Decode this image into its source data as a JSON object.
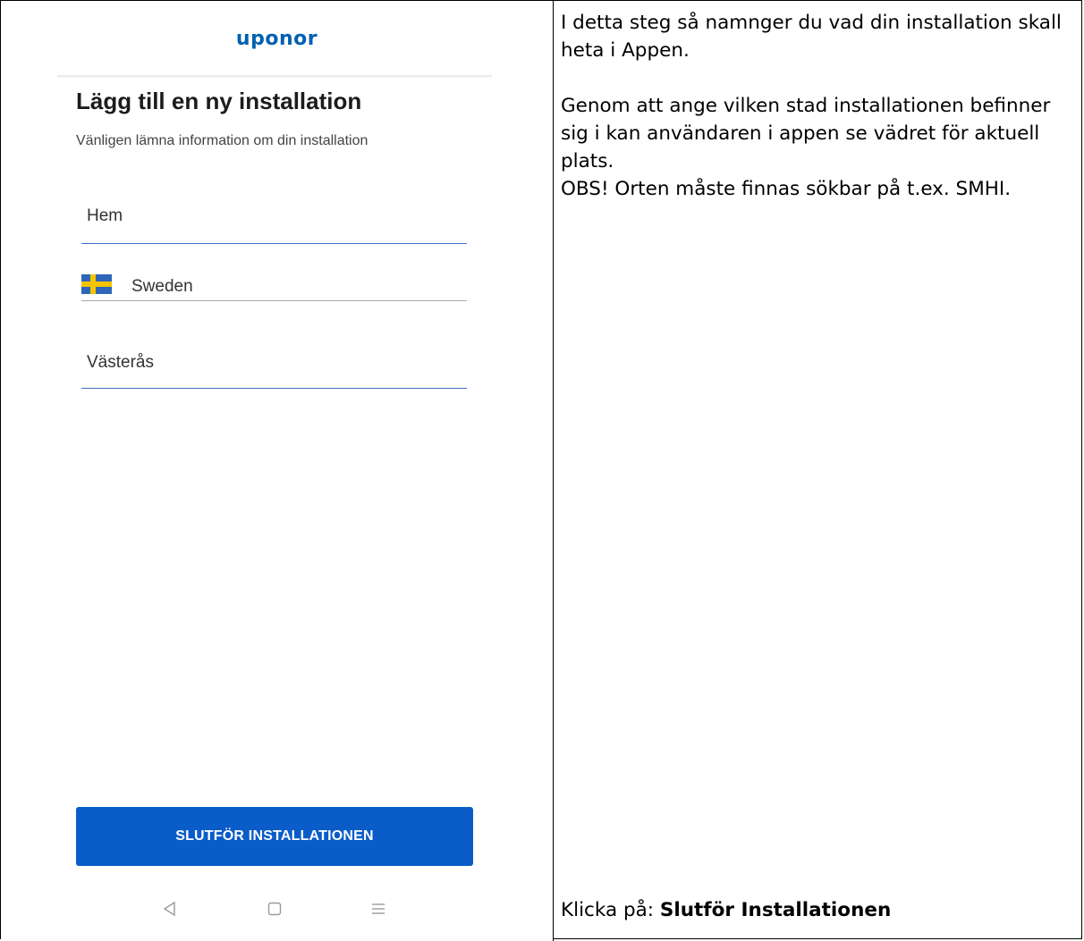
{
  "app": {
    "logo": "uponor",
    "title": "Lägg till en ny installation",
    "subtitle": "Vänligen lämna information om din installation"
  },
  "form": {
    "name_value": "Hem",
    "country_value": "Sweden",
    "country_flag": "sweden-flag",
    "city_value": "Västerås"
  },
  "actions": {
    "finish_label": "SLUTFÖR INSTALLATIONEN"
  },
  "nav": {
    "back_icon": "back-triangle-icon",
    "home_icon": "home-square-icon",
    "menu_icon": "menu-lines-icon"
  },
  "instructions": {
    "p1": "I detta steg så namnger du vad din installation skall heta i Appen.",
    "p2": "Genom att ange vilken stad installationen befinner sig i kan användaren i appen se vädret för aktuell plats.",
    "p3": "OBS! Orten måste finnas sökbar på t.ex. SMHI.",
    "cta_prefix": "Klicka på: ",
    "cta_bold": "Slutför Installationen"
  },
  "colors": {
    "brand": "#0060b0",
    "button": "#0a5cc8",
    "field_underline": "#3a73c0",
    "flag_blue": "#2e66b8",
    "flag_yellow": "#f5c400"
  }
}
